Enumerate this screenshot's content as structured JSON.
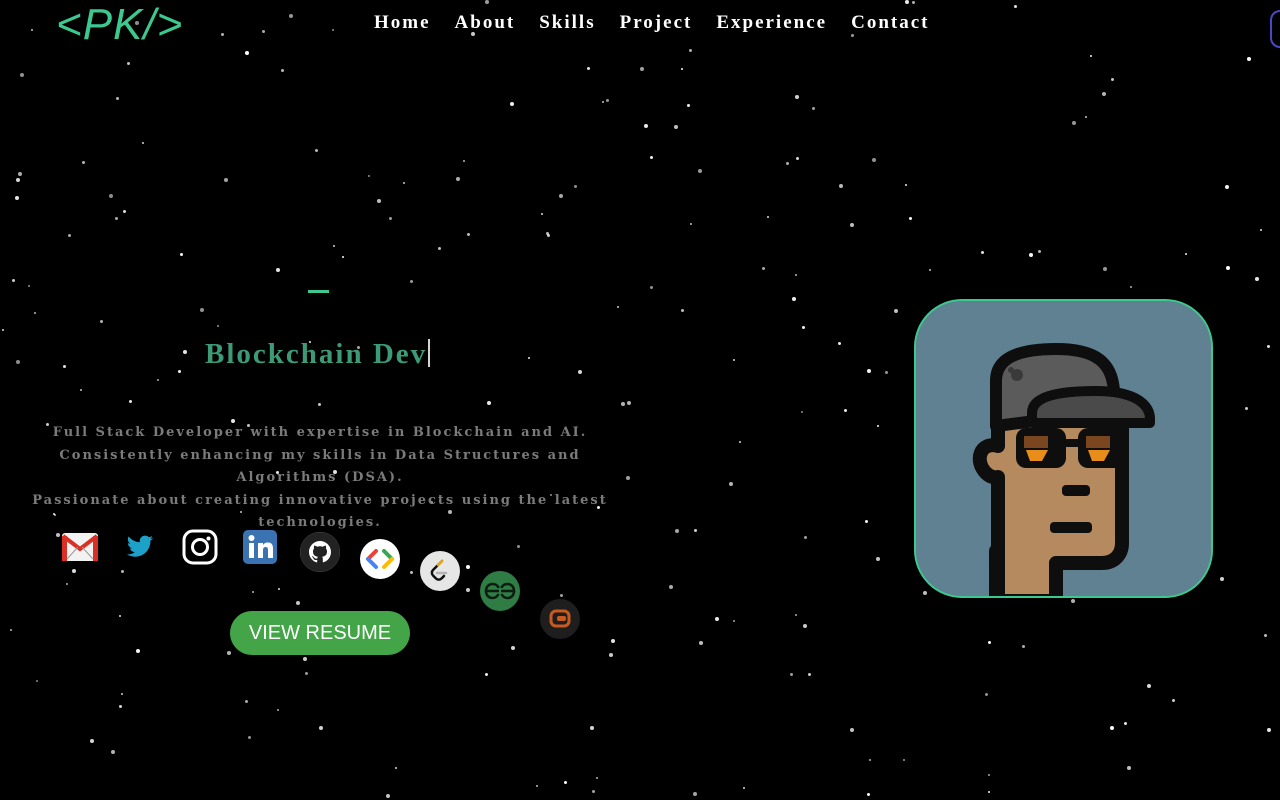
{
  "header": {
    "logo": "<PK/>",
    "nav": [
      "Home",
      "About",
      "Skills",
      "Project",
      "Experience",
      "Contact"
    ]
  },
  "hero": {
    "role": "Blockchain Dev",
    "description": [
      "Full Stack Developer with expertise in Blockchain and AI.",
      "Consistently enhancing my skills in Data Structures and Algorithms (DSA).",
      "Passionate about creating innovative projects using the latest technologies."
    ],
    "resume_button": "VIEW RESUME",
    "social_icons": [
      "gmail-icon",
      "twitter-icon",
      "instagram-icon",
      "linkedin-icon",
      "github-icon",
      "google-developers-icon",
      "leetcode-icon",
      "geeksforgeeks-icon",
      "codechef-icon"
    ]
  },
  "colors": {
    "accent": "#3cc98f",
    "role_text": "#3d9a77",
    "button": "#43a548",
    "avatar_bg": "#5f8192",
    "background": "#000000"
  }
}
